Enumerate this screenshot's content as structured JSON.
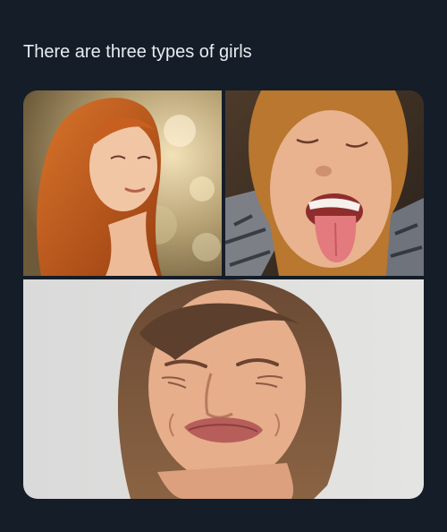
{
  "tweet": {
    "text": "There are three types of girls"
  },
  "media": {
    "photos": [
      {
        "name": "content-face-photo",
        "depicts": "woman with red hair smiling with eyes closed"
      },
      {
        "name": "tongue-out-photo",
        "depicts": "woman with eyes closed sticking tongue out"
      },
      {
        "name": "disgusted-face-photo",
        "depicts": "woman with bob haircut grimacing in disgust"
      }
    ]
  },
  "colors": {
    "background": "#151d28",
    "text": "#e6ecf0"
  }
}
